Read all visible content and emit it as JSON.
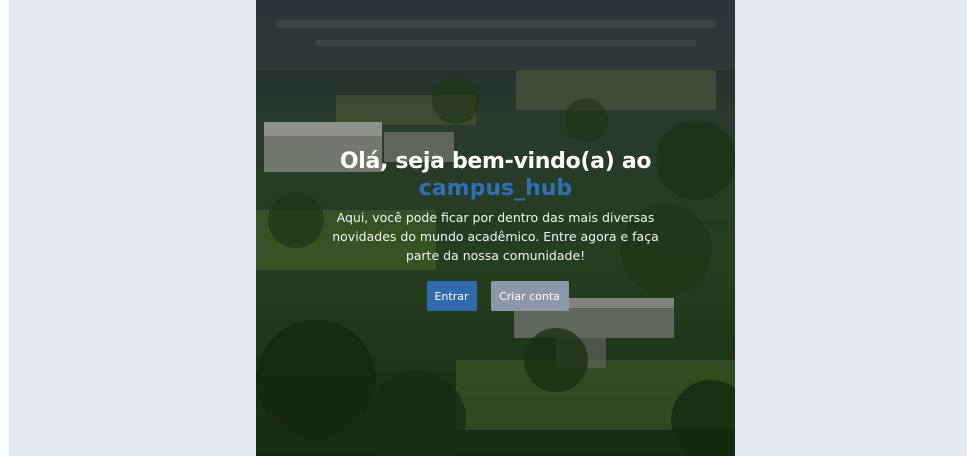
{
  "hero": {
    "headline": "Olá, seja bem-vindo(a) ao",
    "brand": "campus_hub",
    "description": "Aqui, você pode ficar por dentro das mais diversas novidades do mundo acadêmico. Entre agora e faça parte da nossa comunidade!",
    "background_image": "aerial-campus-photo"
  },
  "actions": {
    "login_label": "Entrar",
    "signup_label": "Criar conta"
  },
  "colors": {
    "page_background": "#e4e8f0",
    "brand_accent": "#2f6fb8",
    "primary_button": "#2f6aad",
    "secondary_button": "#8c98a8"
  }
}
